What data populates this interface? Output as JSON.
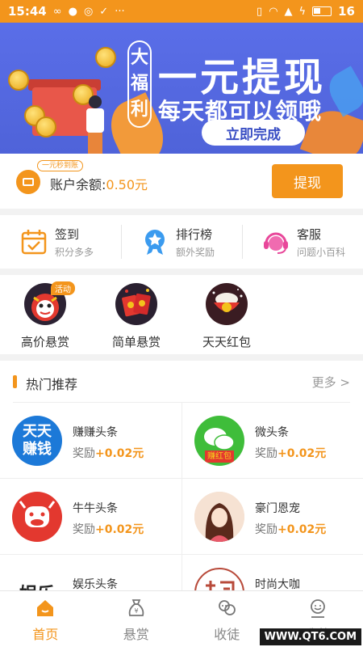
{
  "status_bar": {
    "time": "15:44",
    "battery": "16"
  },
  "banner": {
    "badge": [
      "大",
      "福",
      "利"
    ],
    "title": "一元提现",
    "subtitle": "每天都可以领哦",
    "cta": "立即完成"
  },
  "balance": {
    "tag": "一元秒到账",
    "label": "账户余额:",
    "amount": "0.50元",
    "button": "提现"
  },
  "quick": [
    {
      "title": "签到",
      "sub": "积分多多",
      "icon": "calendar-check-icon"
    },
    {
      "title": "排行榜",
      "sub": "额外奖励",
      "icon": "medal-star-icon"
    },
    {
      "title": "客服",
      "sub": "问题小百科",
      "icon": "headset-icon"
    }
  ],
  "tasks": [
    {
      "label": "高价悬赏",
      "badge": "活动"
    },
    {
      "label": "简单悬赏"
    },
    {
      "label": "天天红包"
    }
  ],
  "hot": {
    "title": "热门推荐",
    "more": "更多 >",
    "reward_prefix": "奖励",
    "items": [
      {
        "name": "赚赚头条",
        "reward": "+0.02元",
        "logo_text": "天天赚钱"
      },
      {
        "name": "微头条",
        "reward": "+0.02元",
        "logo_text": "赚红包"
      },
      {
        "name": "牛牛头条",
        "reward": "+0.02元"
      },
      {
        "name": "豪门恩宠",
        "reward": "+0.02元"
      },
      {
        "name": "娱乐头条",
        "reward": "",
        "logo_text": "娱乐"
      },
      {
        "name": "时尚大咖",
        "reward": ""
      }
    ]
  },
  "nav": [
    {
      "label": "首页",
      "active": true
    },
    {
      "label": "悬赏"
    },
    {
      "label": "收徒"
    },
    {
      "label": "我的"
    }
  ],
  "watermark": "WWW.QT6.COM",
  "colors": {
    "accent": "#f3951c",
    "banner": "#4f63d9"
  }
}
